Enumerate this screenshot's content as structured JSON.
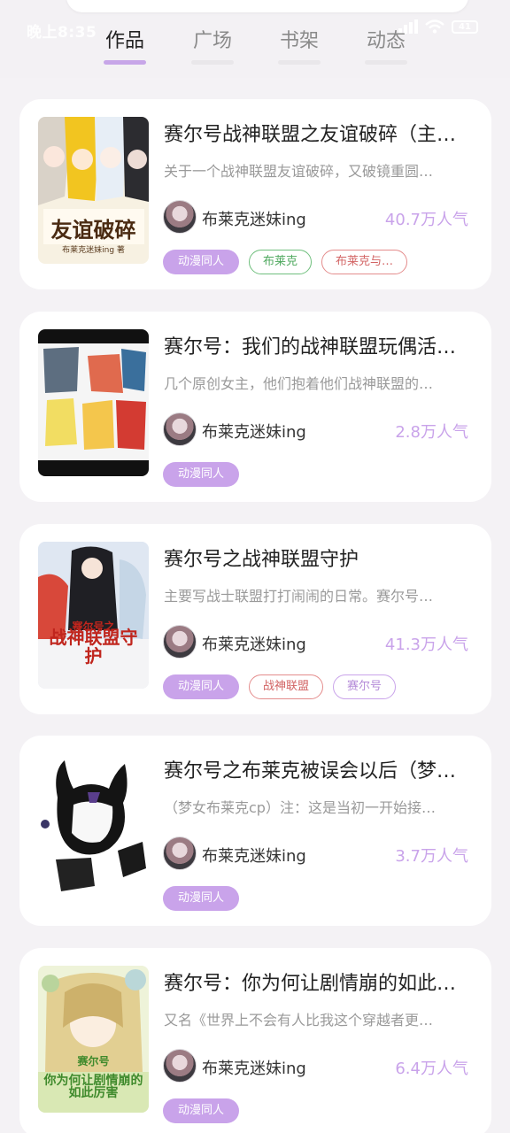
{
  "status_bar": {
    "time": "晚上8:35",
    "battery": "41"
  },
  "tabs": [
    "作品",
    "广场",
    "书架",
    "动态"
  ],
  "active_tab": 0,
  "colors": {
    "accent": "#c9a3ea",
    "tag_green": "#6fbf7d",
    "tag_red": "#e48c8c"
  },
  "cards": [
    {
      "title": "赛尔号战神联盟之友谊破碎（主…",
      "desc": "关于一个战神联盟友谊破碎，又破镜重圆…",
      "author": "布莱克迷妹ing",
      "popularity": "40.7万人气",
      "cover_text": "友谊破碎",
      "cover_sub": "布莱克迷妹ing 著",
      "tags": [
        {
          "label": "动漫同人",
          "style": "filled"
        },
        {
          "label": "布莱克",
          "style": "green"
        },
        {
          "label": "布莱克与…",
          "style": "red"
        }
      ]
    },
    {
      "title": "赛尔号：我们的战神联盟玩偶活…",
      "desc": "几个原创女主，他们抱着他们战神联盟的…",
      "author": "布莱克迷妹ing",
      "popularity": "2.8万人气",
      "cover_text": "",
      "cover_sub": "",
      "tags": [
        {
          "label": "动漫同人",
          "style": "filled"
        }
      ]
    },
    {
      "title": "赛尔号之战神联盟守护",
      "desc": "主要写战士联盟打打闹闹的日常。赛尔号…",
      "author": "布莱克迷妹ing",
      "popularity": "41.3万人气",
      "cover_text": "战神联盟守护",
      "cover_sub": "赛尔号之",
      "tags": [
        {
          "label": "动漫同人",
          "style": "filled"
        },
        {
          "label": "战神联盟",
          "style": "red"
        },
        {
          "label": "赛尔号",
          "style": "purple"
        }
      ]
    },
    {
      "title": "赛尔号之布莱克被误会以后（梦…",
      "desc": "（梦女布莱克cp）注：这是当初一开始接…",
      "author": "布莱克迷妹ing",
      "popularity": "3.7万人气",
      "cover_text": "",
      "cover_sub": "",
      "tags": [
        {
          "label": "动漫同人",
          "style": "filled"
        }
      ]
    },
    {
      "title": "赛尔号：你为何让剧情崩的如此…",
      "desc": "又名《世界上不会有人比我这个穿越者更…",
      "author": "布莱克迷妹ing",
      "popularity": "6.4万人气",
      "cover_text": "你为何让剧情崩的如此厉害",
      "cover_sub": "赛尔号",
      "tags": [
        {
          "label": "动漫同人",
          "style": "filled"
        }
      ]
    }
  ]
}
